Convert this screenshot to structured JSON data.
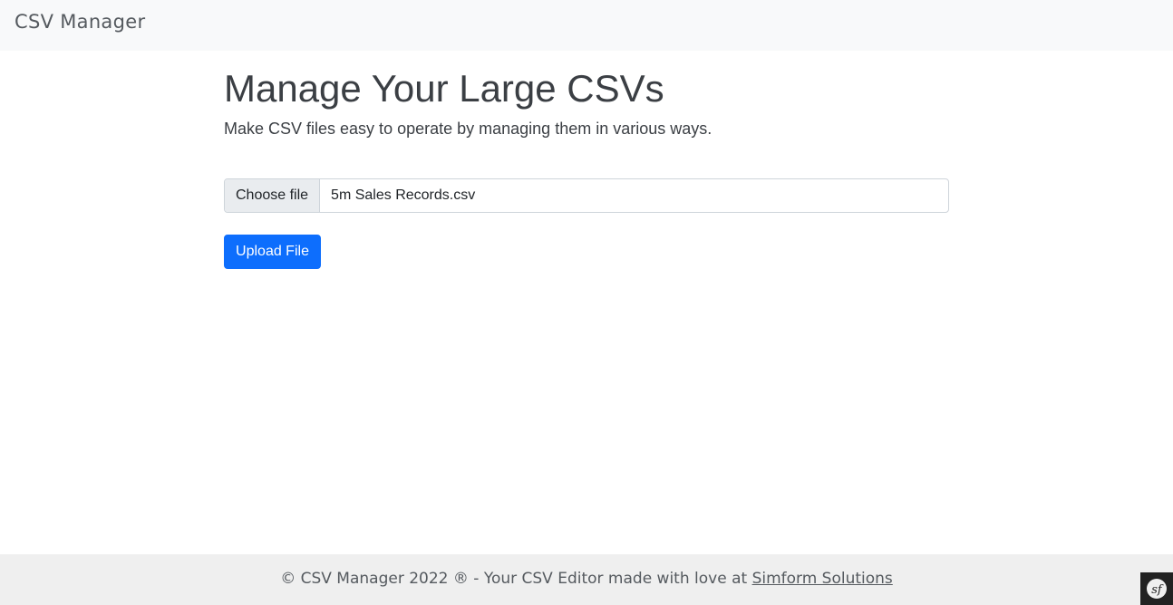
{
  "navbar": {
    "brand": "CSV Manager"
  },
  "main": {
    "title": "Manage Your Large CSVs",
    "subtitle": "Make CSV files easy to operate by managing them in various ways.",
    "file_input": {
      "button_label": "Choose file",
      "file_name": "5m Sales Records.csv"
    },
    "upload_button": "Upload File"
  },
  "footer": {
    "text": "© CSV Manager 2022 ® - Your CSV Editor made with love at ",
    "link": "Simform Solutions"
  },
  "debug_toolbar": {
    "icon": "symfony-icon"
  },
  "colors": {
    "primary": "#0d6efd",
    "navbar_bg": "#f8f9fa",
    "footer_bg": "#efefef",
    "text": "#3b3f44"
  }
}
